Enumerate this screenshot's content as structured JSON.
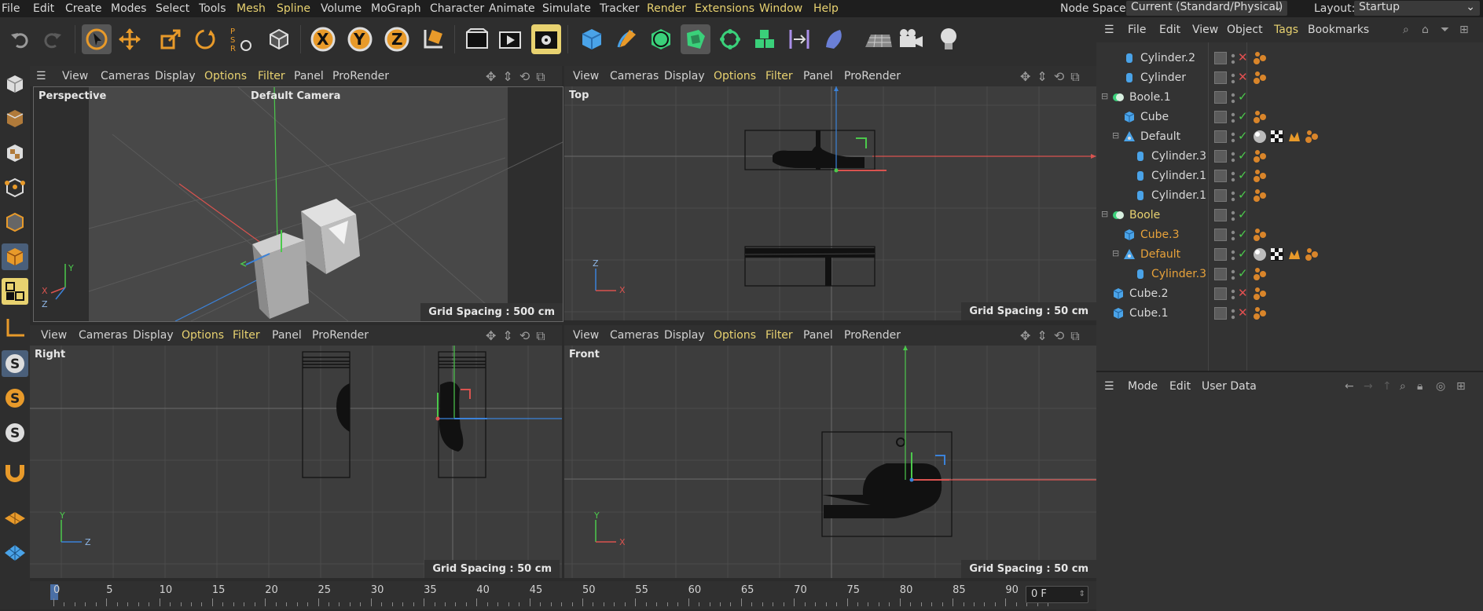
{
  "menubar": {
    "items": [
      "File",
      "Edit",
      "Create",
      "Modes",
      "Select",
      "Tools",
      "Mesh",
      "Spline",
      "Volume",
      "MoGraph",
      "Character",
      "Animate",
      "Simulate",
      "Tracker",
      "Render",
      "Extensions",
      "Window",
      "Help"
    ],
    "node_space_label": "Node Space:",
    "node_space_value": "Current (Standard/Physical)",
    "layout_label": "Layout:",
    "layout_value": "Startup"
  },
  "toolbar": {
    "icons": [
      "undo-icon",
      "redo-icon",
      "select-icon",
      "move-icon",
      "scale-icon",
      "rotate-icon",
      "psr-reset-icon",
      "object-mode-icon",
      "x-axis-icon",
      "y-axis-icon",
      "z-axis-icon",
      "coord-system-icon",
      "render-region-icon",
      "render-view-icon",
      "render-settings-icon",
      "cube-icon",
      "pen-icon",
      "generator-icon",
      "deformer-icon",
      "mograph-icon",
      "cloner-icon",
      "symmetry-icon",
      "field-icon",
      "floor-icon",
      "camera-icon",
      "light-icon"
    ],
    "axis_letters": {
      "x": "X",
      "y": "Y",
      "z": "Z"
    },
    "psr_text": "PSR"
  },
  "viewport_menu": {
    "items": [
      "View",
      "Cameras",
      "Display",
      "Options",
      "Filter",
      "Panel",
      "ProRender"
    ]
  },
  "viewports": {
    "perspective": {
      "label": "Perspective",
      "camera": "Default Camera",
      "grid": "Grid Spacing : 500 cm"
    },
    "top": {
      "label": "Top",
      "grid": "Grid Spacing : 50 cm"
    },
    "right": {
      "label": "Right",
      "grid": "Grid Spacing : 50 cm"
    },
    "front": {
      "label": "Front",
      "grid": "Grid Spacing : 50 cm"
    }
  },
  "axis_labels": {
    "x": "X",
    "y": "Y",
    "z": "Z"
  },
  "timeline": {
    "ticks": [
      "0",
      "5",
      "10",
      "15",
      "20",
      "25",
      "30",
      "35",
      "40",
      "45",
      "50",
      "55",
      "60",
      "65",
      "70",
      "75",
      "80",
      "85",
      "90"
    ],
    "current_frame": "0 F"
  },
  "object_manager": {
    "menu": [
      "File",
      "Edit",
      "View",
      "Object",
      "Tags",
      "Bookmarks"
    ],
    "rows": [
      {
        "name": "Cylinder.2",
        "indent": 1,
        "type": "cylinder",
        "state": "x",
        "tags": [
          "phong"
        ]
      },
      {
        "name": "Cylinder",
        "indent": 1,
        "type": "cylinder",
        "state": "x",
        "tags": [
          "phong"
        ]
      },
      {
        "name": "Boole.1",
        "indent": 0,
        "type": "boole",
        "state": "check",
        "tags": []
      },
      {
        "name": "Cube",
        "indent": 1,
        "type": "cube",
        "state": "check",
        "tags": [
          "phong"
        ]
      },
      {
        "name": "Default",
        "indent": 1,
        "type": "null",
        "state": "check",
        "tags": [
          "material",
          "checker",
          "pose",
          "phong"
        ]
      },
      {
        "name": "Cylinder.3",
        "indent": 2,
        "type": "cylinder",
        "state": "check",
        "tags": [
          "phong"
        ]
      },
      {
        "name": "Cylinder.1",
        "indent": 2,
        "type": "cylinder",
        "state": "check",
        "tags": [
          "phong"
        ]
      },
      {
        "name": "Cylinder.1",
        "indent": 2,
        "type": "cylinder",
        "state": "check",
        "tags": [
          "phong"
        ]
      },
      {
        "name": "Boole",
        "indent": 0,
        "type": "boole",
        "state": "check",
        "tags": [],
        "highlight": true
      },
      {
        "name": "Cube.3",
        "indent": 1,
        "type": "cube",
        "state": "check",
        "tags": [
          "phong"
        ],
        "highlight": true
      },
      {
        "name": "Default",
        "indent": 1,
        "type": "null",
        "state": "check",
        "tags": [
          "material",
          "checker",
          "pose",
          "phong"
        ],
        "highlight": true
      },
      {
        "name": "Cylinder.3",
        "indent": 2,
        "type": "cylinder",
        "state": "check",
        "tags": [
          "phong"
        ],
        "highlight": true
      },
      {
        "name": "Cube.2",
        "indent": 0,
        "type": "cube",
        "state": "x",
        "tags": [
          "phong"
        ]
      },
      {
        "name": "Cube.1",
        "indent": 0,
        "type": "cube",
        "state": "x",
        "tags": [
          "phong"
        ]
      }
    ]
  },
  "attribute_manager": {
    "menu": [
      "Mode",
      "Edit",
      "User Data"
    ]
  },
  "colors": {
    "accent_yellow": "#e8d270",
    "highlight_orange": "#e8a23a",
    "axis_x": "#d9534f",
    "axis_y": "#4cc94c",
    "axis_z": "#3b82d9",
    "check_green": "#4cc94c",
    "x_red": "#e05050"
  }
}
